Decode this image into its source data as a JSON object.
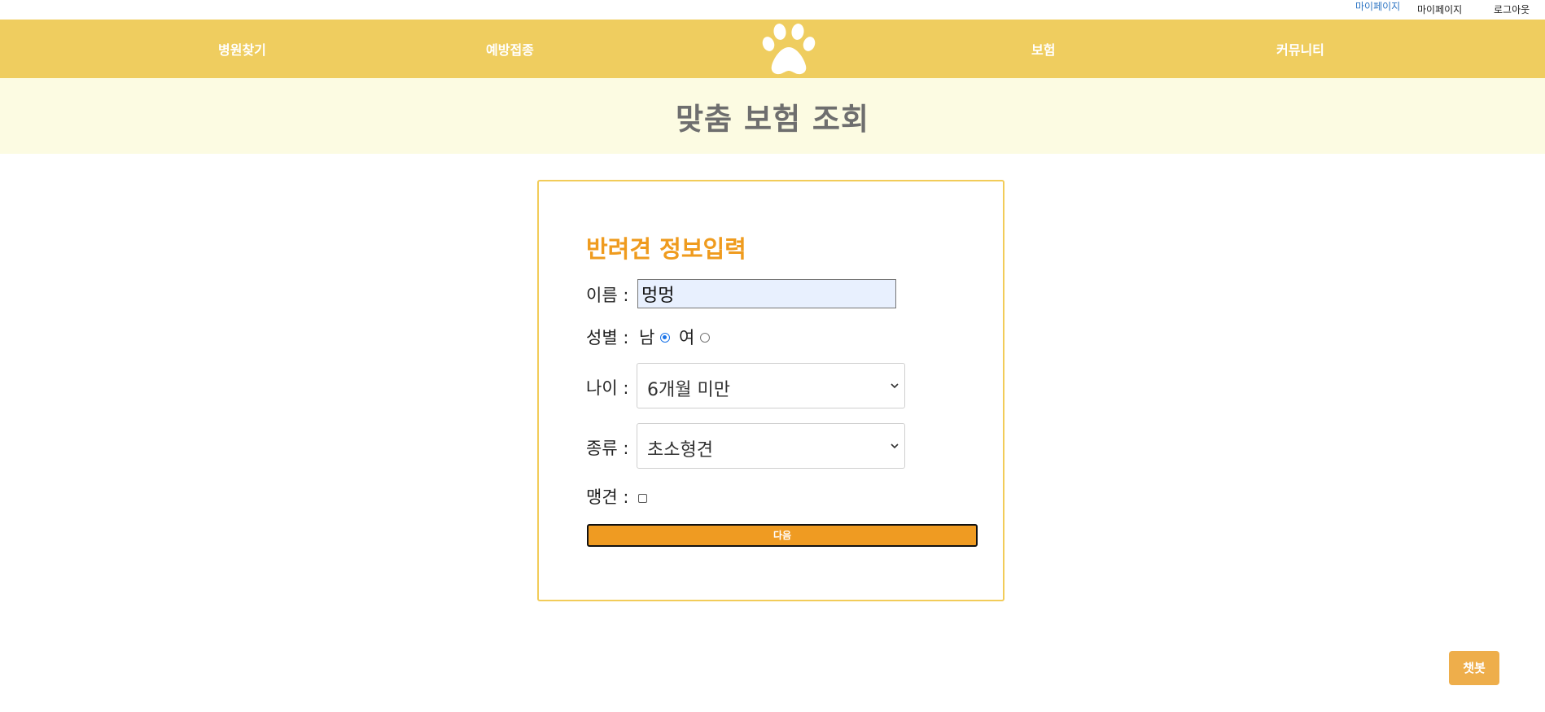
{
  "topbar": {
    "mypage_blue": "마이페이지",
    "mypage": "마이페이지",
    "logout": "로그아웃"
  },
  "nav": {
    "hospital": "병원찾기",
    "vaccine": "예방접종",
    "insurance": "보험",
    "community": "커뮤니티",
    "logo_icon": "paw-icon"
  },
  "page": {
    "title": "맞춤 보험 조회"
  },
  "form": {
    "heading": "반려견 정보입력",
    "name_label": "이름 :",
    "name_value": "멍멍",
    "gender_label": "성별 :",
    "gender_male": "남",
    "gender_female": "여",
    "gender_selected": "남",
    "age_label": "나이 :",
    "age_value": "6개월 미만",
    "kind_label": "종류 :",
    "kind_value": "초소형견",
    "fierce_label": "맹견 :",
    "fierce_checked": false,
    "next_button": "다음"
  },
  "chatbot": {
    "label": "챗봇"
  },
  "colors": {
    "nav_bg": "#efcd5f",
    "title_band_bg": "#fcfbe2",
    "accent_orange": "#ef9b1e",
    "card_border": "#f2cc59",
    "chatbot_bg": "#eeae4b"
  }
}
